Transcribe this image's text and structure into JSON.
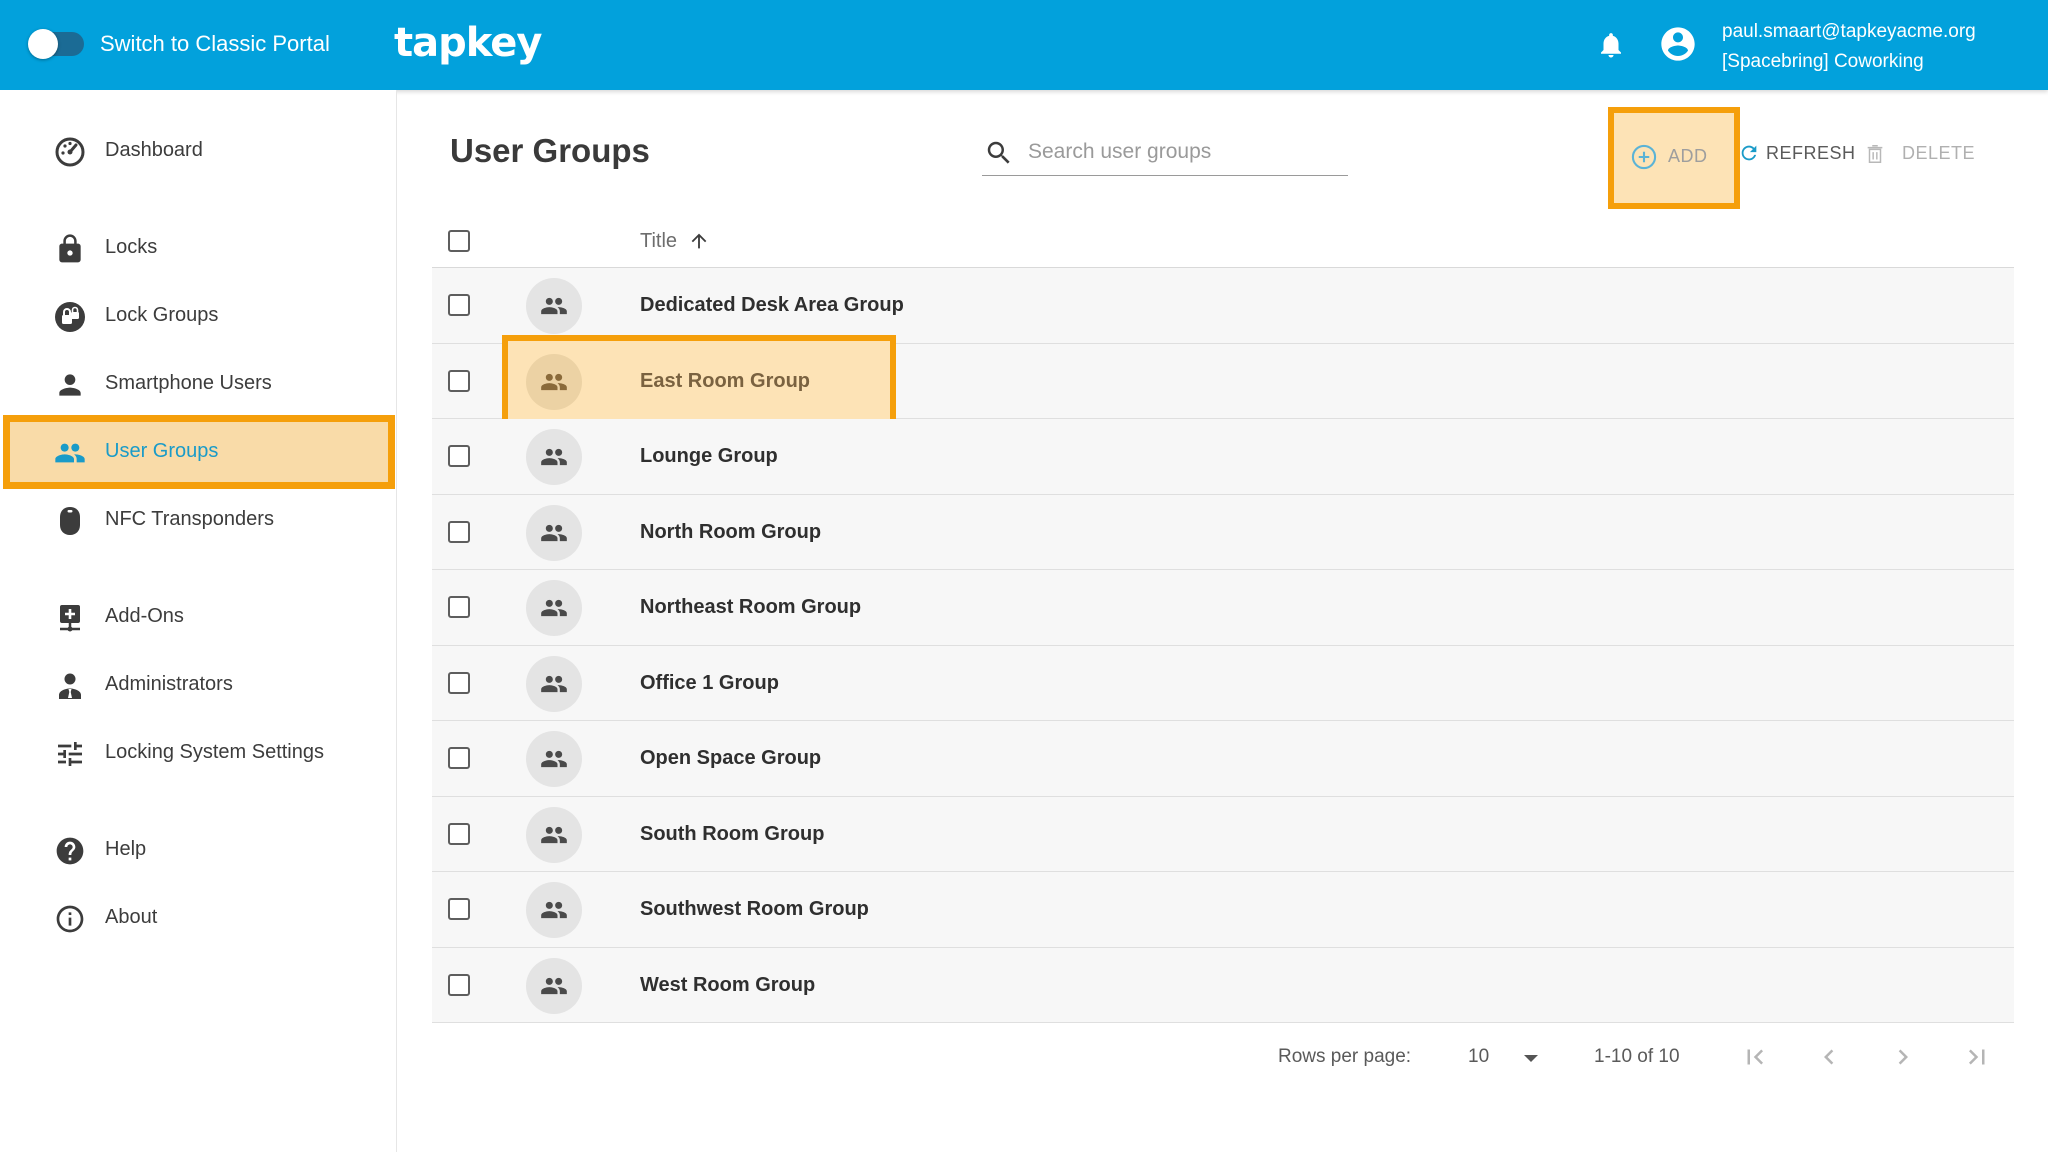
{
  "header": {
    "toggle_label": "Switch to Classic Portal",
    "logo": "tapkey",
    "user_email": "paul.smaart@tapkeyacme.org",
    "user_org": "[Spacebring] Coworking",
    "accent_color": "#02a1dc"
  },
  "sidebar": {
    "items": [
      {
        "label": "Dashboard",
        "icon": "dashboard-icon"
      },
      {
        "label": "Locks",
        "icon": "lock-icon"
      },
      {
        "label": "Lock Groups",
        "icon": "lock-groups-icon"
      },
      {
        "label": "Smartphone Users",
        "icon": "person-icon"
      },
      {
        "label": "User Groups",
        "icon": "people-icon",
        "active": true
      },
      {
        "label": "NFC Transponders",
        "icon": "nfc-transponder-icon"
      },
      {
        "label": "Add-Ons",
        "icon": "add-ons-icon"
      },
      {
        "label": "Administrators",
        "icon": "administrator-icon"
      },
      {
        "label": "Locking System Settings",
        "icon": "settings-sliders-icon"
      },
      {
        "label": "Help",
        "icon": "help-icon"
      },
      {
        "label": "About",
        "icon": "info-icon"
      }
    ]
  },
  "main": {
    "title": "User Groups",
    "search_placeholder": "Search user groups",
    "actions": {
      "add": "ADD",
      "refresh": "REFRESH",
      "delete": "DELETE"
    },
    "table": {
      "column_title": "Title",
      "sort": "ascending",
      "rows": [
        "Dedicated Desk Area Group",
        "East Room Group",
        "Lounge Group",
        "North Room Group",
        "Northeast Room Group",
        "Office 1 Group",
        "Open Space Group",
        "South Room Group",
        "Southwest Room Group",
        "West Room Group"
      ],
      "highlighted_row": "East Room Group"
    },
    "pagination": {
      "rows_per_page_label": "Rows per page:",
      "rows_per_page": "10",
      "range": "1-10 of 10"
    }
  },
  "highlight_color": "#f59f0b"
}
